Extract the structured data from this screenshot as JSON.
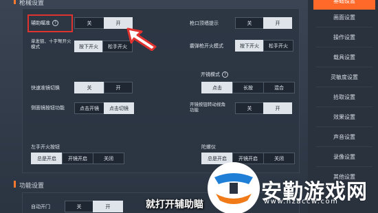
{
  "sections": {
    "gun_settings": "枪械设置",
    "feature_settings": "功能设置"
  },
  "rows": {
    "aim_assist": {
      "label": "辅助瞄准",
      "opts": [
        "关",
        "开"
      ]
    },
    "muzzle_hint": {
      "label": "枪口顶墙提示",
      "opts": [
        "关",
        "开"
      ]
    },
    "single_fire": {
      "label": "单发狙、十字弩开火模式",
      "opts": [
        "按下开火",
        "松手开火"
      ]
    },
    "burst_fire": {
      "label": "霰弹枪开火模式",
      "opts": [
        "按下开火",
        "松手开火"
      ]
    },
    "open_scope_mode": {
      "label": "开镜模式"
    },
    "scope_tabs": {
      "opts": [
        "点击",
        "长按",
        "混合"
      ]
    },
    "quick_scope": {
      "label": "快速准镜切换",
      "opts": [
        "关",
        "开"
      ]
    },
    "side_scope": {
      "label": "侧面镜按钮功能",
      "opts": [
        "点击开镜",
        "点击切镜"
      ]
    },
    "scope_btn_view": {
      "label": "开镜按钮转动视角功能",
      "opts": [
        "关",
        "开"
      ]
    },
    "left_fire": {
      "label": "左手开火按钮",
      "opts": [
        "总是开启",
        "开镜开启",
        "关闭"
      ]
    },
    "gyro": {
      "label": "陀螺仪",
      "opts": [
        "总是开启",
        "开镜开启",
        "关闭"
      ]
    },
    "auto_door": {
      "label": "自动开门",
      "opts": [
        "关",
        "开"
      ]
    }
  },
  "sidebar": {
    "items": [
      "基础设置",
      "画面设置",
      "操作设置",
      "载具设置",
      "灵敏度设置",
      "拾取设置",
      "效果设置",
      "声音设置",
      "录像设置",
      "其他设置"
    ]
  },
  "overlay": {
    "caption": "就打开辅助瞄",
    "watermark_title": "安勤游戏网",
    "watermark_url": "www.hzaccw.com"
  },
  "colors": {
    "accent": "#ff6a2a",
    "highlight": "#e0322e",
    "selected": "#dfe4ea"
  }
}
